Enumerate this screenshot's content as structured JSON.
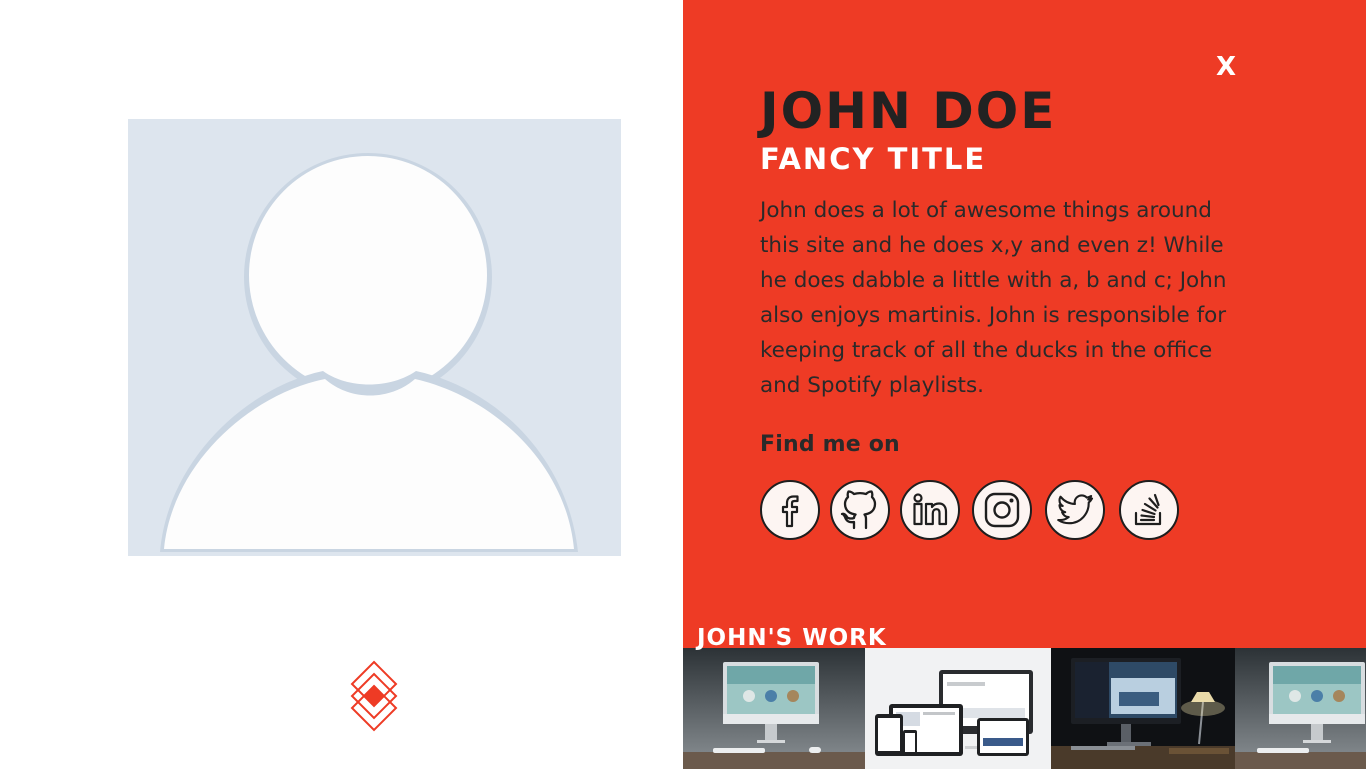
{
  "profile": {
    "close_label": "X",
    "name": "John Doe",
    "title": "Fancy Title",
    "bio": "John does a lot of awesome things around this site and he does x,y and even z! While he does dabble a little with a, b and c; John also enjoys martinis. John is responsible for keeping track of all the ducks in the office and Spotify playlists.",
    "find_me_label": "Find me on"
  },
  "social": [
    {
      "icon": "facebook-icon"
    },
    {
      "icon": "github-icon"
    },
    {
      "icon": "linkedin-icon"
    },
    {
      "icon": "instagram-icon"
    },
    {
      "icon": "twitter-icon"
    },
    {
      "icon": "stackoverflow-icon"
    }
  ],
  "work": {
    "heading": "John's Work",
    "thumbnails": [
      {
        "icon": "desktop-mockup-image"
      },
      {
        "icon": "responsive-devices-image"
      },
      {
        "icon": "night-desk-image"
      },
      {
        "icon": "desktop-mockup-image"
      }
    ]
  },
  "colors": {
    "accent": "#ee3b25",
    "avatar_bg": "#dde5ee",
    "text_dark": "#222222",
    "white": "#ffffff"
  }
}
